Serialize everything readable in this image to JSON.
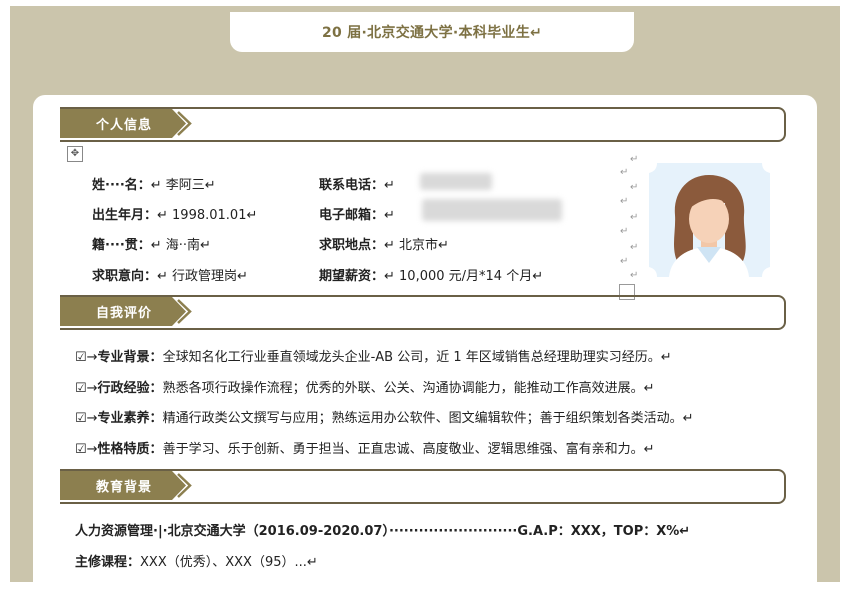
{
  "header": {
    "title": "20 届·北京交通大学·本科毕业生↵"
  },
  "sections": {
    "personal": "个人信息",
    "self_eval": "自我评价",
    "education": "教育背景",
    "mark": "↵"
  },
  "personal": {
    "name_label": "姓····名：",
    "name_value": "↵  李阿三↵",
    "phone_label": "联系电话：",
    "phone_value": "↵",
    "birth_label": "出生年月：",
    "birth_value": "↵  1998.01.01↵",
    "email_label": "电子邮箱：",
    "email_value": "↵",
    "native_label": "籍····贯：",
    "native_value": "↵  海··南↵",
    "location_label": "求职地点：",
    "location_value": "↵  北京市↵",
    "intent_label": "求职意向：",
    "intent_value": "↵  行政管理岗↵",
    "salary_label": "期望薪资：",
    "salary_value": "↵  10,000 元/月*14 个月↵"
  },
  "self_eval": [
    {
      "bullet": "☑→",
      "label": "专业背景：",
      "text": "全球知名化工行业垂直领域龙头企业-AB 公司，近 1 年区域销售总经理助理实习经历。↵"
    },
    {
      "bullet": "☑→",
      "label": "行政经验：",
      "text": "熟悉各项行政操作流程；优秀的外联、公关、沟通协调能力，能推动工作高效进展。↵"
    },
    {
      "bullet": "☑→",
      "label": "专业素养：",
      "text": "精通行政类公文撰写与应用；熟练运用办公软件、图文编辑软件；善于组织策划各类活动。↵"
    },
    {
      "bullet": "☑→",
      "label": "性格特质：",
      "text": "善于学习、乐于创新、勇于担当、正直忠诚、高度敬业、逻辑思维强、富有亲和力。↵"
    }
  ],
  "education": {
    "line1": "人力资源管理·|·北京交通大学（2016.09-2020.07）··························G.A.P：XXX，TOP：X%↵",
    "course_label": "主修课程：",
    "course_text": "XXX（优秀）、XXX（95）...↵"
  },
  "icons": {
    "anchor": "move-anchor-icon",
    "photo": "avatar-photo"
  },
  "colors": {
    "accent": "#8c7f4f",
    "background": "#cbc5ac",
    "border": "#6a6046"
  }
}
